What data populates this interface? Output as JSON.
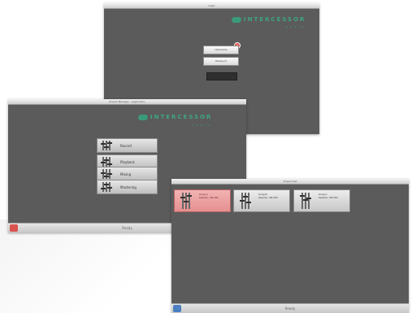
{
  "brand": {
    "name": "INTERCESSOR",
    "tagline": "A U D I O"
  },
  "window_login": {
    "title": "Login",
    "field_user": "Username",
    "field_password": "Password"
  },
  "window_menu": {
    "title": "Project Manager - Application",
    "items": [
      {
        "label": "Record"
      },
      {
        "label": "Playback"
      },
      {
        "label": "Mixing"
      },
      {
        "label": "Mastering"
      }
    ],
    "status": "Ready",
    "corner_button_color": "#d9534f"
  },
  "window_projects": {
    "title": "Project List",
    "tiles": [
      {
        "name": "Song A",
        "desc": "Session, 48 kHz",
        "selected": true
      },
      {
        "name": "Song B",
        "desc": "Session, 48 kHz",
        "selected": false
      },
      {
        "name": "Song C",
        "desc": "Session, 48 kHz",
        "selected": false
      }
    ],
    "status": "Ready",
    "corner_button_color": "#4a7fc1"
  },
  "colors": {
    "window_bg": "#5b5b5b",
    "accent": "#3ea582",
    "selected_tile": "#e58f8f"
  }
}
